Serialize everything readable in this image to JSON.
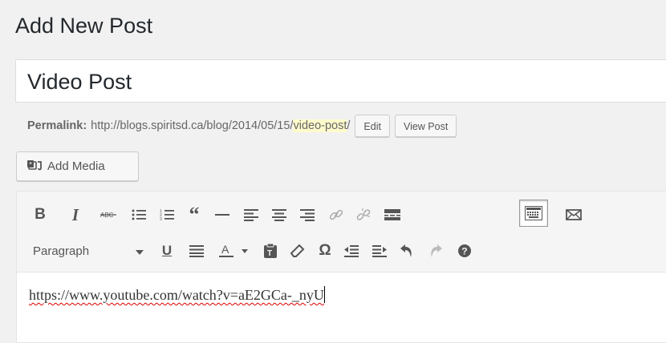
{
  "page": {
    "title": "Add New Post"
  },
  "post": {
    "title": "Video Post"
  },
  "permalink": {
    "label": "Permalink:",
    "base_url": "http://blogs.spiritsd.ca/blog/2014/05/15/",
    "slug": "video-post",
    "trailing": "/",
    "edit_label": "Edit",
    "view_label": "View Post"
  },
  "media": {
    "add_label": "Add Media"
  },
  "toolbar": {
    "row1": [
      "bold-icon",
      "italic-icon",
      "strikethrough-icon",
      "bullet-list-icon",
      "numbered-list-icon",
      "blockquote-icon",
      "horizontal-rule-icon",
      "align-left-icon",
      "align-center-icon",
      "align-right-icon",
      "link-icon",
      "unlink-icon",
      "read-more-icon",
      "toolbar-toggle-icon",
      "email-icon"
    ],
    "row2": [
      "underline-icon",
      "justify-icon",
      "text-color-icon",
      "paste-text-icon",
      "clear-formatting-icon",
      "special-character-icon",
      "outdent-icon",
      "indent-icon",
      "undo-icon",
      "redo-icon",
      "help-icon"
    ],
    "format_select": {
      "value": "Paragraph"
    }
  },
  "editor": {
    "content": "https://www.youtube.com/watch?v=aE2GCa-_nyU"
  },
  "colors": {
    "slug_highlight": "#fffbcc",
    "spell_underline": "#d00"
  }
}
